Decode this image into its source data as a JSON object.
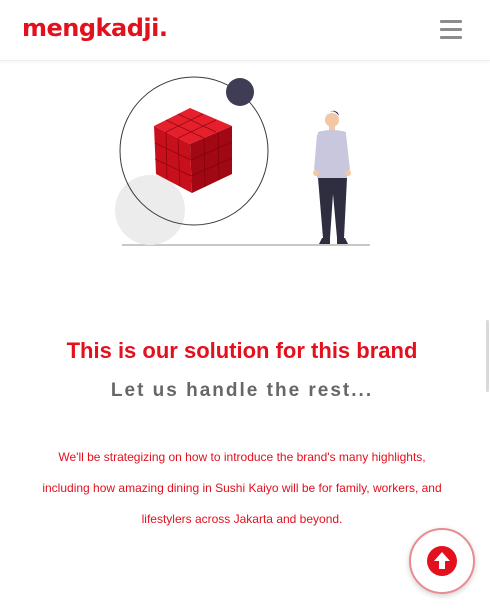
{
  "header": {
    "logo_text": "mengkadji.",
    "menu_icon": "hamburger-menu-icon"
  },
  "hero": {
    "illustration": "person-with-red-cube-illustration"
  },
  "content": {
    "headline": "This is our solution for this brand",
    "subheadline": "Let us handle the rest...",
    "body": "We'll be strategizing on how to introduce the brand's many highlights, including how amazing dining in Sushi Kaiyo will be for family, workers, and lifestylers across Jakarta and beyond."
  },
  "back_to_top": {
    "icon": "arrow-up-icon"
  },
  "colors": {
    "brand_red": "#e3101e",
    "text_gray": "#676767",
    "menu_gray": "#8c8c8c"
  }
}
